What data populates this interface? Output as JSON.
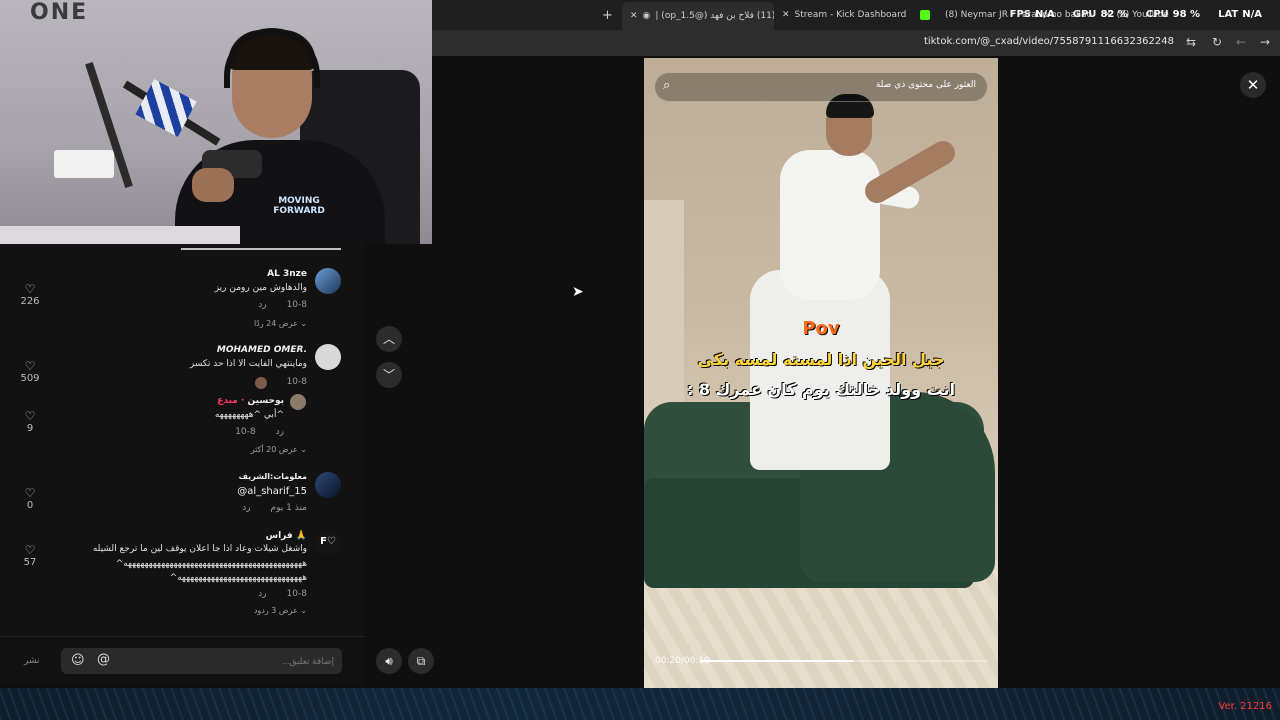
{
  "browser": {
    "tabs": [
      {
        "label": "(11) فلاح بن فهد (@op_1.5) |",
        "active": true
      },
      {
        "label": "Stream - Kick Dashboard",
        "active": false
      },
      {
        "label": "(8) Neymar JR - Parado no bailão",
        "active": false
      },
      {
        "label": "(8) YouTube",
        "active": false
      }
    ],
    "new_tab_label": "+",
    "url": "tiktok.com/@_cxad/video/7558791116632362248"
  },
  "overlay_stats": [
    {
      "key": "FPS",
      "value": "N/A"
    },
    {
      "key": "GPU",
      "value": "82 %"
    },
    {
      "key": "CPU",
      "value": "98 %"
    },
    {
      "key": "LAT",
      "value": "N/A"
    }
  ],
  "webcam": {
    "wall_text": "ONE",
    "shirt_text": "MOVING FORWARD"
  },
  "comments": [
    {
      "name": "AL 3nze",
      "text": "والدهاوش مين رومن ريز",
      "date": "10-8",
      "reply": "رد",
      "replies_label": "عرض 24 ردًا",
      "likes": "226",
      "avatar_color": "#3b5f8a"
    },
    {
      "name": "MOHAMED OMER.",
      "text": "وماينتهي الفايت الا اذا حد تكسر",
      "date": "10-8",
      "reply": "رد",
      "likes": "509",
      "avatar_color": "#d4d4d4"
    },
    {
      "name": "بوحسين",
      "badge": "· مبدع",
      "text": "أبي ^ههههههههه^",
      "date": "10-8",
      "reply": "رد",
      "replies_label": "عرض 20 أكثر",
      "likes": "9",
      "avatar_color": "#7a6a5a"
    },
    {
      "name": "معلومات:الشريف",
      "text": "@al_sharif_15",
      "date": "منذ 1 يوم",
      "reply": "رد",
      "likes": "0",
      "avatar_color": "#1c2a44"
    },
    {
      "name": "فراس 🙏",
      "text": "واشغل شيلات وعاد اذا جا اعلان يوقف لين ما ترجع الشيله",
      "text2": "^هههههههههههههههههههههههههههههههههههههههههههه",
      "text3": "^ههههههههههههههههههههههههههههههه",
      "date": "10-8",
      "reply": "رد",
      "replies_label": "عرض 3 ردود",
      "likes": "57",
      "avatar_color": "#151515",
      "avatar_text": "F♡"
    }
  ],
  "comment_input": {
    "placeholder": "إضافة تعليق...",
    "post_label": "نشر",
    "emoji_icon": "☺",
    "mention_icon": "@"
  },
  "video": {
    "search_placeholder": "العثور على محتوى ذي صلة",
    "caption_line1": "Pov",
    "caption_line2": "جيل الحين اذا لمسته لمسه بكى",
    "caption_line3": "انت وولد خالتك يوم كان عمرك 8 :",
    "time": "00:20/00:10",
    "progress": 0.53
  },
  "taskbar": {
    "version": "Ver. 21216"
  }
}
